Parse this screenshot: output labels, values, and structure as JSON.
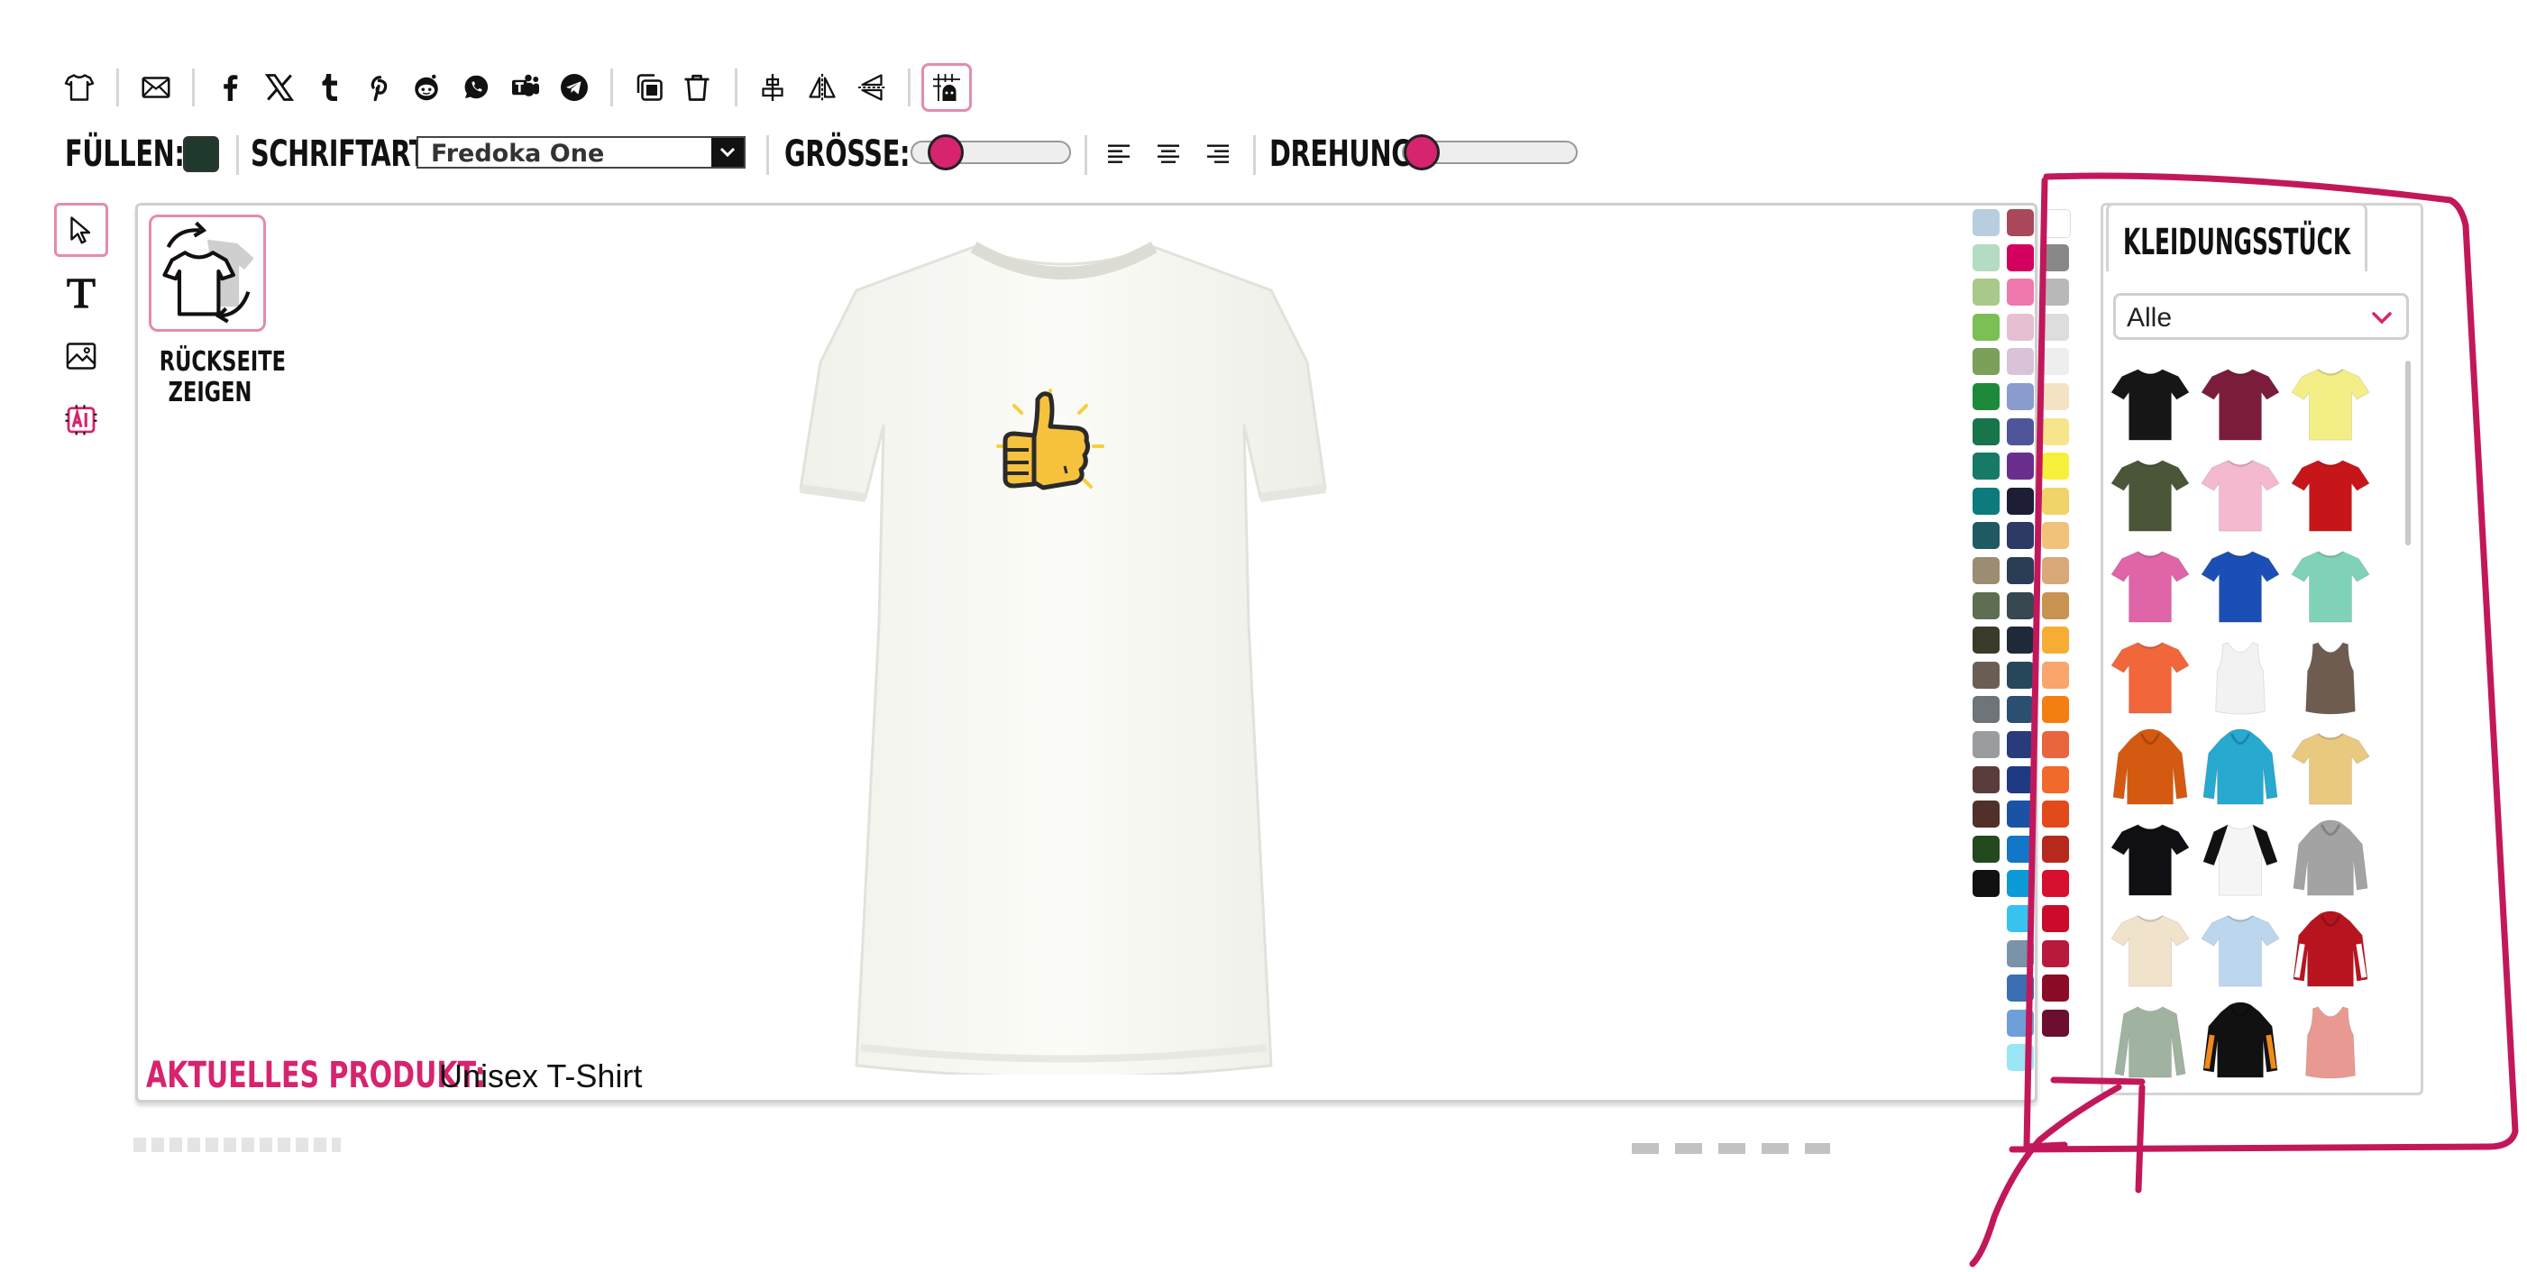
{
  "toolbar": {
    "icons": [
      "tshirt-icon",
      "mail-icon",
      "facebook-icon",
      "x-icon",
      "tumblr-icon",
      "pinterest-icon",
      "reddit-icon",
      "whatsapp-icon",
      "teams-icon",
      "telegram-icon",
      "duplicate-icon",
      "delete-icon",
      "align-center-icon",
      "flip-horizontal-icon",
      "flip-vertical-icon",
      "grid-toggle-icon"
    ]
  },
  "format": {
    "fill_label": "FÜLLEN:",
    "fill_color": "#1f3a2c",
    "font_label": "SCHRIFTART:",
    "font_value": "Fredoka One",
    "size_label": "GRÖSSE:",
    "size_level": 0.12,
    "rotation_label": "DREHUNG:",
    "rotation_level": 0.0,
    "align_icons": [
      "align-left-icon",
      "align-center-text-icon",
      "align-right-icon"
    ]
  },
  "tools": [
    "select-pointer-icon",
    "text-tool-icon",
    "image-tool-icon",
    "ai-tool-icon"
  ],
  "canvas": {
    "back_label": "RÜCKSEITE ZEIGEN",
    "product_key": "AKTUELLES PRODUKT:",
    "product_name": "Unisex T-Shirt",
    "design_motif": "thumbs-up-icon"
  },
  "palette": {
    "col1": [
      "#b8cde0",
      "#b3dcc2",
      "#a9c98b",
      "#7bbf55",
      "#7aa05a",
      "#1c8a3a",
      "#17744b",
      "#177a66",
      "#0d7b7d",
      "#1f5a63",
      "#9b8c72",
      "#5d6e52",
      "#3c3a2a",
      "#6b5f55",
      "#6f7478",
      "#9a9c9e",
      "#5b3c3c",
      "#503028",
      "#23491e",
      "#111111"
    ],
    "col2": [
      "#a8485a",
      "#d4005f",
      "#ef79ad",
      "#e6bfd2",
      "#d9c3d9",
      "#8a9bcf",
      "#4f5599",
      "#6a2f8d",
      "#1d1d35",
      "#2d3a66",
      "#2b3d55",
      "#36474f",
      "#1e2a3a",
      "#27485a",
      "#2b4f70",
      "#283b7a",
      "#1f3a82",
      "#1a53a5",
      "#1277c8",
      "#0c9bd6",
      "#38c2f0",
      "#7a93a8",
      "#3a6fb3",
      "#6f9fd8",
      "#9be6f5"
    ],
    "col3": [
      "#ffffff",
      "#888888",
      "#b8b8b8",
      "#dddddd",
      "#eeeeee",
      "#f3e3c4",
      "#f7e58b",
      "#f6f03c",
      "#f1d36a",
      "#f1c27a",
      "#d8a878",
      "#c89250",
      "#f7ad34",
      "#f9a56b",
      "#f57e12",
      "#e8653e",
      "#ef6a2c",
      "#e24a1a",
      "#b52a1c",
      "#d6102e",
      "#cc0b2a",
      "#b81a3d",
      "#8b0c27",
      "#6b0e2f"
    ]
  },
  "panel": {
    "tab_label": "KLEIDUNGSSTÜCK",
    "category_value": "Alle",
    "garments": [
      {
        "name": "black-tshirt",
        "color": "#161616",
        "type": "tee"
      },
      {
        "name": "maroon-tshirt",
        "color": "#7b1d3a",
        "type": "tee"
      },
      {
        "name": "yellow-tshirt",
        "color": "#f3ef86",
        "type": "tee"
      },
      {
        "name": "olive-tshirt",
        "color": "#4b5538",
        "type": "tee"
      },
      {
        "name": "pink-tshirt",
        "color": "#f4b8d0",
        "type": "tee"
      },
      {
        "name": "red-tshirt",
        "color": "#c7161a",
        "type": "tee"
      },
      {
        "name": "fuchsia-tshirt",
        "color": "#e064a8",
        "type": "tee"
      },
      {
        "name": "royal-blue-tshirt",
        "color": "#1c4fb5",
        "type": "tee"
      },
      {
        "name": "mint-tshirt",
        "color": "#7fd1b8",
        "type": "tee"
      },
      {
        "name": "coral-tshirt",
        "color": "#f2663c",
        "type": "tee"
      },
      {
        "name": "white-tank",
        "color": "#f2f2f2",
        "type": "tank"
      },
      {
        "name": "brown-tank",
        "color": "#6e5c50",
        "type": "tank"
      },
      {
        "name": "orange-hoodie",
        "color": "#d45a12",
        "type": "hoodie"
      },
      {
        "name": "turquoise-hoodie",
        "color": "#27a9d0",
        "type": "hoodie"
      },
      {
        "name": "tiedye-tshirt",
        "color": "#e9c87f",
        "type": "tee"
      },
      {
        "name": "black-tshirt-2",
        "color": "#0f0f14",
        "type": "tee"
      },
      {
        "name": "baseball-tshirt",
        "color": "#f5f5f5",
        "type": "raglan"
      },
      {
        "name": "grey-hoodie",
        "color": "#a3a3a3",
        "type": "hoodie"
      },
      {
        "name": "cream-tshirt",
        "color": "#f1e2cc",
        "type": "tee"
      },
      {
        "name": "skyblue-tshirt",
        "color": "#bcd6ee",
        "type": "tee"
      },
      {
        "name": "red-varsity-jacket",
        "color": "#b8141f",
        "type": "jacket"
      },
      {
        "name": "sage-longsleeve",
        "color": "#9fb3a0",
        "type": "longsleeve"
      },
      {
        "name": "black-orange-hoodie",
        "color": "#111111",
        "type": "hoodie"
      },
      {
        "name": "peach-tank",
        "color": "#e89a92",
        "type": "tank"
      }
    ]
  },
  "annotation": {
    "color": "#c2185b"
  }
}
